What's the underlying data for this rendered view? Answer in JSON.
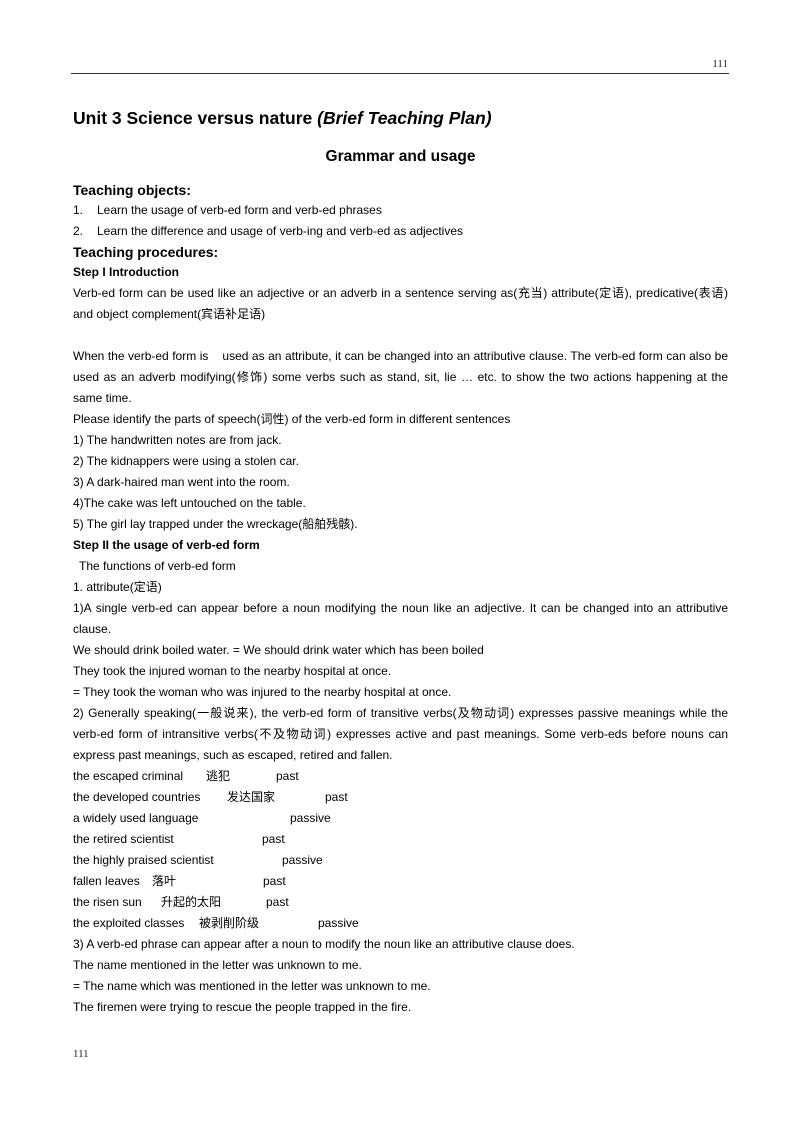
{
  "page": {
    "number_top": "111",
    "number_bottom": "111"
  },
  "title": {
    "main": "Unit 3 Science versus nature ",
    "italic": "(Brief Teaching Plan)"
  },
  "subtitle": "Grammar and usage",
  "teaching_objects": {
    "heading": "Teaching objects:",
    "items": [
      {
        "num": "1.",
        "text": "Learn the usage of verb-ed form and verb-ed phrases"
      },
      {
        "num": "2.",
        "text": "Learn the difference and usage of verb-ing and verb-ed as adjectives"
      }
    ]
  },
  "teaching_procedures": {
    "heading": "Teaching procedures:",
    "step1": {
      "heading": "Step I Introduction",
      "para1": "Verb-ed form can be used like an adjective or an adverb in a sentence serving as(充当) attribute(定语), predicative(表语) and object complement(宾语补足语)",
      "para2": "When the verb-ed form is    used as an attribute, it can be changed into an attributive clause. The verb-ed form can also be used as an adverb modifying(修饰) some verbs such as stand, sit, lie … etc. to show the two actions happening at the same time.",
      "para3": "Please identify the parts of speech(词性) of the verb-ed form in different sentences",
      "sentences": [
        "1) The handwritten notes are from jack.",
        "2) The kidnappers were using a stolen car.",
        "3) A dark-haired man went into the room.",
        "4)The cake was left untouched on the table.",
        "5) The girl lay trapped under the wreckage(船舶残骸)."
      ]
    },
    "step2": {
      "heading": "Step II the usage of verb-ed form",
      "functions_label": "The functions of verb-ed form",
      "attribute_heading": "1. attribute(定语)",
      "point1": "1)A single verb-ed can appear before a noun modifying the noun like an adjective. It can be changed into an attributive clause.",
      "examples1": [
        "We should drink boiled water. = We should drink water which has been boiled",
        "They took the injured woman to the nearby hospital at once.",
        "= They took the woman who was injured to the nearby hospital at once."
      ],
      "point2": "2) Generally speaking(一般说来), the verb-ed form of transitive verbs(及物动词) expresses passive meanings while the verb-ed form of intransitive verbs(不及物动词) expresses active and past meanings. Some verb-eds before nouns can express past meanings, such as escaped, retired and fallen.",
      "phrase_table": [
        {
          "phrase": "the escaped criminal",
          "chinese": "逃犯",
          "meaning": "past"
        },
        {
          "phrase": "the developed countries",
          "chinese": "发达国家",
          "meaning": "past"
        },
        {
          "phrase": "a widely used language",
          "chinese": "",
          "meaning": "passive"
        },
        {
          "phrase": "the retired scientist",
          "chinese": "",
          "meaning": "past"
        },
        {
          "phrase": "the highly praised scientist",
          "chinese": "",
          "meaning": "passive"
        },
        {
          "phrase": "fallen leaves",
          "chinese": "落叶",
          "meaning": "past"
        },
        {
          "phrase": "the risen sun",
          "chinese": "升起的太阳",
          "meaning": "past"
        },
        {
          "phrase": "the exploited classes",
          "chinese": "被剥削阶级",
          "meaning": "passive"
        }
      ],
      "point3": "3) A verb-ed phrase can appear after a noun to modify the noun like an attributive clause does.",
      "examples3": [
        "The name mentioned in the letter was unknown to me.",
        "= The name which was mentioned in the letter was unknown to me.",
        "The firemen were trying to rescue the people trapped in the fire."
      ]
    }
  }
}
